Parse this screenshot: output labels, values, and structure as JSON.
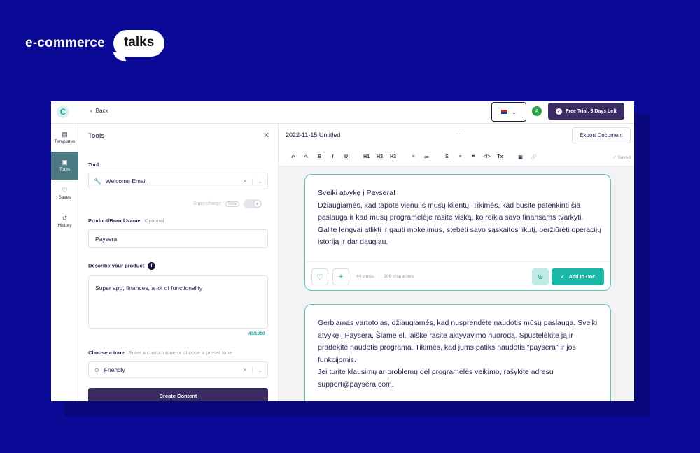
{
  "brand": {
    "left": "e-commerce",
    "bubble": "talks"
  },
  "topbar": {
    "logo": "C",
    "back_label": "Back",
    "avatar_initial": "A",
    "trial_label": "Free Trial: 3 Days Left"
  },
  "sidebar": {
    "items": [
      {
        "label": "Templates",
        "icon": "template-icon"
      },
      {
        "label": "Tools",
        "icon": "tools-icon",
        "active": true
      },
      {
        "label": "Saves",
        "icon": "heart-icon"
      },
      {
        "label": "History",
        "icon": "history-icon"
      }
    ]
  },
  "tools": {
    "title": "Tools",
    "tool_label": "Tool",
    "tool_value": "Welcome Email",
    "supercharge_label": "Supercharge",
    "beta_label": "beta",
    "product_label": "Product/Brand Name",
    "product_optional": "Optional",
    "product_value": "Paysera",
    "describe_label": "Describe your product",
    "describe_value": "Super app, finances, a lot of functionality",
    "describe_counter": "43/1000",
    "tone_label": "Choose a tone",
    "tone_hint": "Enter a custom tone or choose a preset tone",
    "tone_value": "Friendly",
    "create_label": "Create Content"
  },
  "editor": {
    "doc_title": "2022-11-15 Untitled",
    "export_label": "Export Document",
    "saved_label": "Saved",
    "toolbar": [
      "↶",
      "↷",
      "B",
      "I",
      "U",
      "|",
      "H1",
      "H2",
      "H3",
      "|",
      "≡",
      "≔",
      "|",
      "S",
      "≡",
      "❞",
      "</>",
      "Tx",
      "|",
      "▣",
      "🔗"
    ]
  },
  "results": [
    {
      "text": "Sveiki atvykę į Paysera!\nDžiaugiamės, kad tapote vienu iš mūsų klientų. Tikimės, kad būsite patenkinti šia paslauga ir kad mūsų programėlėje rasite viską, ko reikia savo finansams tvarkyti. Galite lengvai atlikti ir gauti mokėjimus, stebėti savo sąskaitos likutį, peržiūrėti operacijų istoriją ir dar daugiau.",
      "words": "44 words",
      "characters": "309 characters",
      "add_label": "Add to Doc"
    },
    {
      "text": "Gerbiamas vartotojas, džiaugiamės, kad nusprendėte naudotis mūsų paslauga. Sveiki atvykę į Paysera. Šiame el. laiške rasite aktyvavimo nuorodą. Spustelėkite ją ir pradėkite naudotis programa. Tikimės, kad jums patiks naudotis \"paysera\" ir jos funkcijomis.\nJei turite klausimų ar problemų dėl programėlės veikimo, rašykite adresu support@paysera.com."
    }
  ],
  "fab_label": "C",
  "colors": {
    "background": "#0b0a96",
    "accent": "#1cb8a8",
    "primary": "#3a2c62"
  }
}
